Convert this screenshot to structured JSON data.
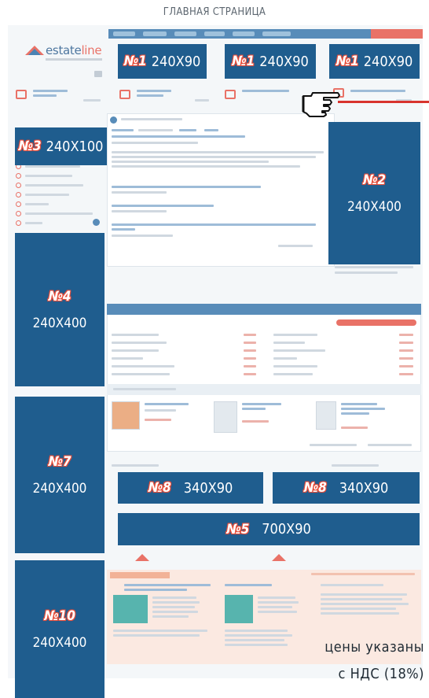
{
  "heading": "ГЛАВНАЯ СТРАНИЦА",
  "logo": {
    "part1": "estate",
    "part2": "line"
  },
  "ad_blocks": {
    "b1a": {
      "num": "№1",
      "size": "240X90"
    },
    "b1b": {
      "num": "№1",
      "size": "240X90"
    },
    "b1c": {
      "num": "№1",
      "size": "240X90"
    },
    "b2": {
      "num": "№2",
      "size": "240X400"
    },
    "b3": {
      "num": "№3",
      "size": "240X100"
    },
    "b4": {
      "num": "№4",
      "size": "240X400"
    },
    "b7": {
      "num": "№7",
      "size": "240X400"
    },
    "b8a": {
      "num": "№8",
      "size": "340X90"
    },
    "b8b": {
      "num": "№8",
      "size": "340X90"
    },
    "b5": {
      "num": "№5",
      "size": "700X90"
    },
    "b10": {
      "num": "№10",
      "size": "240X400"
    }
  },
  "note": {
    "line1": "цены указаны",
    "line2": "с НДС (18%)"
  },
  "colors": {
    "ad_block": "#1f5d8e",
    "number_outline": "#e94e3a",
    "site_blue": "#3b78ad",
    "site_red": "#e65a4d"
  },
  "icons": {
    "pointer": "pointing-hand-icon"
  }
}
